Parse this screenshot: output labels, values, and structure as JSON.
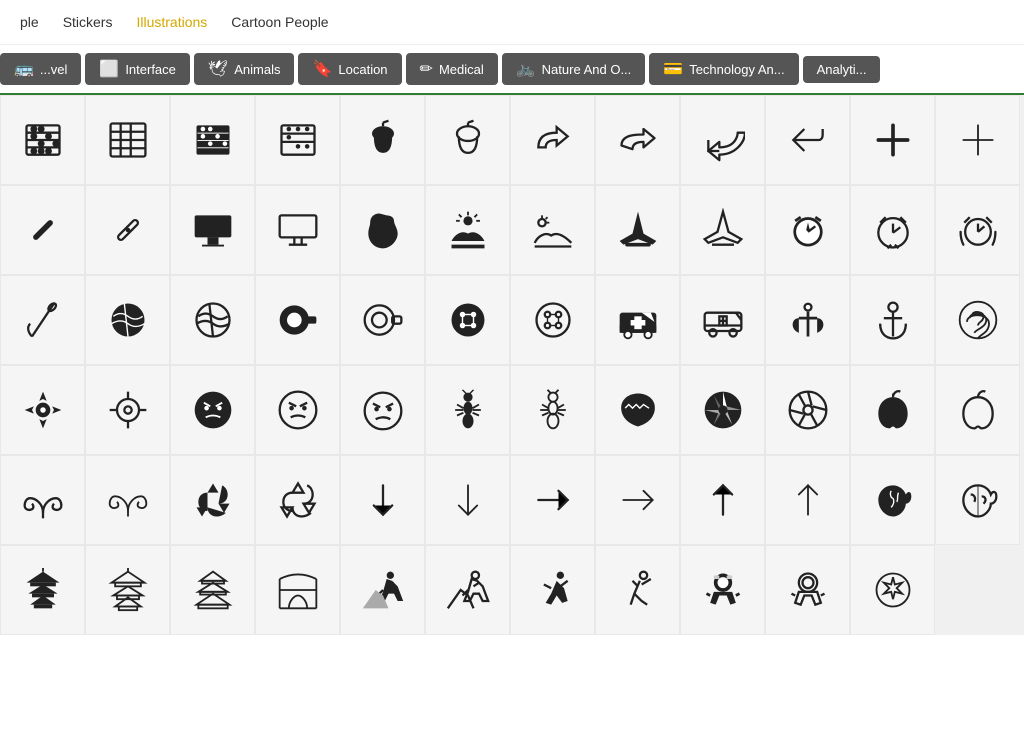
{
  "topnav": {
    "items": [
      {
        "label": "...",
        "class": "ellipsis"
      },
      {
        "label": "Stickers",
        "class": "stickers"
      },
      {
        "label": "Illustrations",
        "class": "illustrations"
      },
      {
        "label": "Cartoon People",
        "class": "cartoon-people"
      }
    ]
  },
  "categorybar": {
    "items": [
      {
        "label": "...vel",
        "icon": "🚌"
      },
      {
        "label": "Interface",
        "icon": "⬜"
      },
      {
        "label": "Animals",
        "icon": "🕊"
      },
      {
        "label": "Location",
        "icon": "🔖"
      },
      {
        "label": "Medical",
        "icon": "✏"
      },
      {
        "label": "Nature And O...",
        "icon": "🚲"
      },
      {
        "label": "Technology An...",
        "icon": "💳"
      },
      {
        "label": "Analyti...",
        "icon": ""
      }
    ]
  },
  "icons": {
    "rows": [
      [
        "abacus-outline",
        "abacus-grid",
        "abacus-filled",
        "abacus-dots",
        "acorn-filled",
        "acorn-outline",
        "arrow-curve-right",
        "arrow-curve-right2",
        "arrow-return-left",
        "arrow-return-left2",
        "plus-bold",
        "plus-thin"
      ],
      [
        "bandage-diagonal",
        "bandage-outline",
        "billboard-filled",
        "billboard-outline",
        "africa-map",
        "farm-sun",
        "farm-landscape",
        "airplane-filled",
        "airplane-outline",
        "alarm-clock-filled",
        "alarm-clock-outline",
        "alarm-clock-ring"
      ],
      [
        "needle-thread",
        "yarn-ball-filled",
        "yarn-ball-outline",
        "tape-measure-filled",
        "tape-measure-outline",
        "button-four",
        "button-four-outline",
        "ambulance-cross",
        "ambulance-outline",
        "anchor-filled",
        "anchor-outline",
        "fingerprint-circle"
      ],
      [
        "target-cross-filled",
        "target-cross-outline",
        "angry-face-filled",
        "angry-face-outline",
        "angry-face-outline2",
        "ant-filled",
        "ant-outline",
        "antarctica-map",
        "aperture-filled",
        "aperture-outline",
        "apple-filled",
        "apple-outline"
      ],
      [
        "aries-filled",
        "aries-outline",
        "recycle-arrows-filled",
        "recycle-arrows-outline",
        "arrow-down-filled",
        "arrow-down-outline",
        "arrow-right-filled",
        "arrow-right-outline",
        "arrow-up-filled",
        "arrow-up-outline",
        "head-brain",
        "head-brain2"
      ],
      [
        "pagoda-filled",
        "pagoda-outline",
        "pagoda-2",
        "arch-pavilion",
        "mountain-climber",
        "mountain-climber2",
        "star-jump",
        "person-reach",
        "astronaut-filled",
        "astronaut-outline",
        "sparkle-circle"
      ]
    ]
  }
}
